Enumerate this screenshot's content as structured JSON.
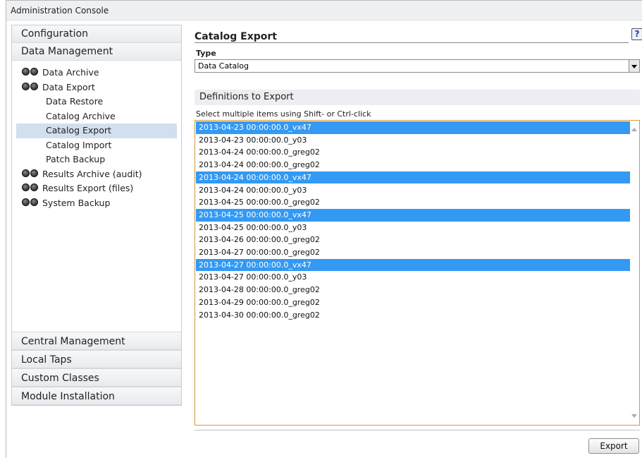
{
  "window": {
    "title": "Administration Console"
  },
  "sidebar": {
    "top_sections": [
      "Configuration",
      "Data Management"
    ],
    "items": [
      {
        "label": "Data Archive",
        "kind": "top",
        "icon": "two-circles-icon"
      },
      {
        "label": "Data Export",
        "kind": "top",
        "icon": "two-circles-icon"
      },
      {
        "label": "Data Restore",
        "kind": "sub"
      },
      {
        "label": "Catalog Archive",
        "kind": "sub"
      },
      {
        "label": "Catalog Export",
        "kind": "sub",
        "active": true
      },
      {
        "label": "Catalog Import",
        "kind": "sub"
      },
      {
        "label": "Patch Backup",
        "kind": "sub"
      },
      {
        "label": "Results Archive (audit)",
        "kind": "top",
        "icon": "two-circles-icon"
      },
      {
        "label": "Results Export (files)",
        "kind": "top",
        "icon": "two-circles-icon"
      },
      {
        "label": "System Backup",
        "kind": "top",
        "icon": "two-circles-icon"
      }
    ],
    "bottom_sections": [
      "Central Management",
      "Local Taps",
      "Custom Classes",
      "Module Installation"
    ]
  },
  "main": {
    "title": "Catalog Export",
    "help_icon": "?",
    "type_label": "Type",
    "type_value": "Data Catalog",
    "definitions_header": "Definitions to Export",
    "hint": "Select multiple items using Shift- or Ctrl-click",
    "definitions": [
      {
        "text": "2013-04-23 00:00:00.0_vx47",
        "selected": true
      },
      {
        "text": "2013-04-23 00:00:00.0_y03",
        "selected": false
      },
      {
        "text": "2013-04-24 00:00:00.0_greg02",
        "selected": false
      },
      {
        "text": "2013-04-24 00:00:00.0_greg02",
        "selected": false
      },
      {
        "text": "2013-04-24 00:00:00.0_vx47",
        "selected": true
      },
      {
        "text": "2013-04-24 00:00:00.0_y03",
        "selected": false
      },
      {
        "text": "2013-04-25 00:00:00.0_greg02",
        "selected": false
      },
      {
        "text": "2013-04-25 00:00:00.0_vx47",
        "selected": true
      },
      {
        "text": "2013-04-25 00:00:00.0_y03",
        "selected": false
      },
      {
        "text": "2013-04-26 00:00:00.0_greg02",
        "selected": false
      },
      {
        "text": "2013-04-27 00:00:00.0_greg02",
        "selected": false
      },
      {
        "text": "2013-04-27 00:00:00.0_vx47",
        "selected": true
      },
      {
        "text": "2013-04-27 00:00:00.0_y03",
        "selected": false
      },
      {
        "text": "2013-04-28 00:00:00.0_greg02",
        "selected": false
      },
      {
        "text": "2013-04-29 00:00:00.0_greg02",
        "selected": false
      },
      {
        "text": "2013-04-30 00:00:00.0_greg02",
        "selected": false
      }
    ],
    "export_label": "Export"
  },
  "colors": {
    "selection": "#3399f3",
    "active_nav": "#d2dfee",
    "listbox_border": "#d29a3c"
  }
}
